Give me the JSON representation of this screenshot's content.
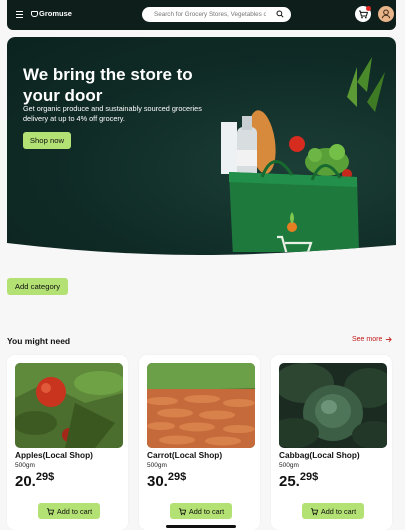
{
  "navbar": {
    "logo_text": "Gromuse",
    "search_placeholder": "Search for Grocery Stores, Vegetables or Meat",
    "icons": [
      "menu-icon",
      "logo-icon",
      "search-icon",
      "cart-icon",
      "user-icon"
    ],
    "colors": {
      "bar": "#0e1f1b",
      "badge": "#e02424",
      "avatar": "#e8b48a"
    }
  },
  "hero": {
    "title": "We bring the store to your door",
    "subtitle": "Get organic produce and sustainably sourced groceries delivery at up to 4% off grocery.",
    "button_label": "Shop now"
  },
  "add_category_label": "Add category",
  "section": {
    "title": "You might need",
    "see_more": "See more"
  },
  "products": [
    {
      "name": "Apples(Local Shop)",
      "weight": "500gm",
      "price_main": "20.",
      "price_cents": "29$",
      "button": "Add to cart"
    },
    {
      "name": "Carrot(Local Shop)",
      "weight": "500gm",
      "price_main": "30.",
      "price_cents": "29$",
      "button": "Add to cart"
    },
    {
      "name": "Cabbag(Local Shop)",
      "weight": "500gm",
      "price_main": "25.",
      "price_cents": "29$",
      "button": "Add to cart"
    }
  ],
  "theme": {
    "accent": "#b3e173",
    "link": "#c21a1a"
  }
}
